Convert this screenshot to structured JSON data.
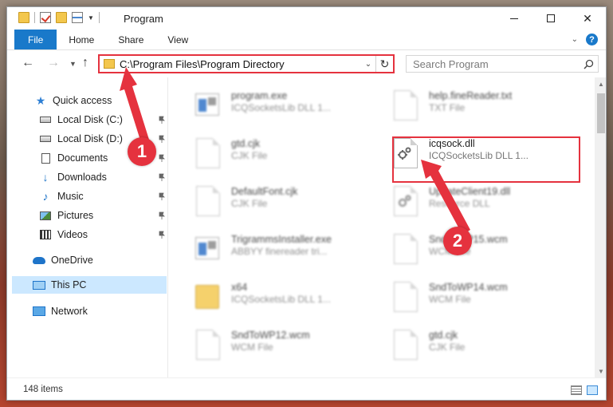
{
  "window": {
    "title": "Program",
    "caption": {
      "minimize": "—",
      "maximize": "□",
      "close": "✕"
    }
  },
  "ribbon": {
    "tabs": [
      {
        "label": "File",
        "active": true
      },
      {
        "label": "Home"
      },
      {
        "label": "Share"
      },
      {
        "label": "View"
      }
    ],
    "help_label": "?"
  },
  "navigation": {
    "address": "C:\\Program Files\\Program Directory",
    "search_placeholder": "Search Program"
  },
  "sidebar": {
    "quick_access": "Quick access",
    "items": [
      {
        "label": "Local Disk (C:)",
        "icon": "drive-icon",
        "pinned": true
      },
      {
        "label": "Local Disk (D:)",
        "icon": "drive-icon",
        "pinned": true
      },
      {
        "label": "Documents",
        "icon": "documents-icon",
        "pinned": true
      },
      {
        "label": "Downloads",
        "icon": "downloads-icon",
        "pinned": true
      },
      {
        "label": "Music",
        "icon": "music-icon",
        "pinned": true
      },
      {
        "label": "Pictures",
        "icon": "pictures-icon",
        "pinned": true
      },
      {
        "label": "Videos",
        "icon": "videos-icon",
        "pinned": true
      }
    ],
    "onedrive": "OneDrive",
    "this_pc": "This PC",
    "network": "Network"
  },
  "files": [
    {
      "name": "program.exe",
      "type": "ICQSocketsLib DLL 1...",
      "icon": "application-icon"
    },
    {
      "name": "help.fineReader.txt",
      "type": "TXT File",
      "icon": "text-file-icon"
    },
    {
      "name": "gtd.cjk",
      "type": "CJK File",
      "icon": "generic-file-icon"
    },
    {
      "name": "icqsock.dll",
      "type": "ICQSocketsLib DLL 1...",
      "icon": "dll-gear-icon",
      "highlighted": true
    },
    {
      "name": "DefaultFont.cjk",
      "type": "CJK File",
      "icon": "generic-file-icon"
    },
    {
      "name": "UpdateClient19.dll",
      "type": "Resource DLL",
      "icon": "dll-gear-icon"
    },
    {
      "name": "TrigrammsInstaller.exe",
      "type": "ABBYY finereader tri...",
      "icon": "application-icon"
    },
    {
      "name": "SndToWP15.wcm",
      "type": "WCM File",
      "icon": "generic-file-icon"
    },
    {
      "name": "x64",
      "type": "ICQSocketsLib DLL 1...",
      "icon": "folder-icon"
    },
    {
      "name": "SndToWP14.wcm",
      "type": "WCM File",
      "icon": "generic-file-icon"
    },
    {
      "name": "SndToWP12.wcm",
      "type": "WCM File",
      "icon": "generic-file-icon"
    },
    {
      "name": "gtd.cjk",
      "type": "CJK File",
      "icon": "generic-file-icon"
    }
  ],
  "status": {
    "item_count": "148 items"
  },
  "annotations": {
    "step1": "1",
    "step2": "2",
    "accent_color": "#e5323e"
  }
}
